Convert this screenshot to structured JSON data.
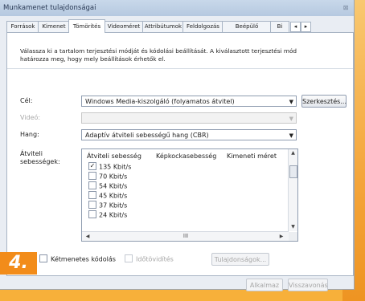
{
  "window": {
    "title": "Munkamenet tulajdonságai",
    "close_glyph": "⊠"
  },
  "tabs": [
    "Források",
    "Kimenet",
    "Tömörítés",
    "Videoméret",
    "Attribútumok",
    "Feldolgozás",
    "Beépülő modulok",
    "Bi"
  ],
  "active_tab": "Tömörítés",
  "tab_nav": {
    "prev": "◂",
    "next": "▸"
  },
  "description": "Válassza ki a tartalom terjesztési módját és kódolási beállítását. A kiválasztott terjesztési mód határozza meg, hogy mely beállítások érhetők el.",
  "target": {
    "label": "Cél:",
    "value": "Windows Media-kiszolgáló (folyamatos átvitel)",
    "edit_button": "Szerkesztés..."
  },
  "video": {
    "label": "Videó:",
    "value": ""
  },
  "audio": {
    "label": "Hang:",
    "value": "Adaptív átviteli sebességű hang (CBR)"
  },
  "bitrates": {
    "label": "Átviteli sebességek:",
    "columns": [
      "Átviteli sebesség",
      "Képkockasebesség",
      "Kimeneti méret"
    ],
    "rows": [
      {
        "label": "135 Kbit/s",
        "checked": true
      },
      {
        "label": "70 Kbit/s",
        "checked": false
      },
      {
        "label": "54 Kbit/s",
        "checked": false
      },
      {
        "label": "45 Kbit/s",
        "checked": false
      },
      {
        "label": "37 Kbit/s",
        "checked": false
      },
      {
        "label": "24 Kbit/s",
        "checked": false
      }
    ],
    "scroll_thumb_glyph": "III"
  },
  "options": {
    "two_pass": "Kétmenetes kódolás",
    "time_compression": "Időtövidítés",
    "properties_button": "Tulajdonságok..."
  },
  "footer": {
    "apply_button": "Alkalmaz",
    "revert_button": "Visszavonás"
  },
  "badge": "4.",
  "colors": {
    "accent": "#f28c1a",
    "window_bg": "#e9edf3",
    "title_bg": "#c8d8ea"
  }
}
